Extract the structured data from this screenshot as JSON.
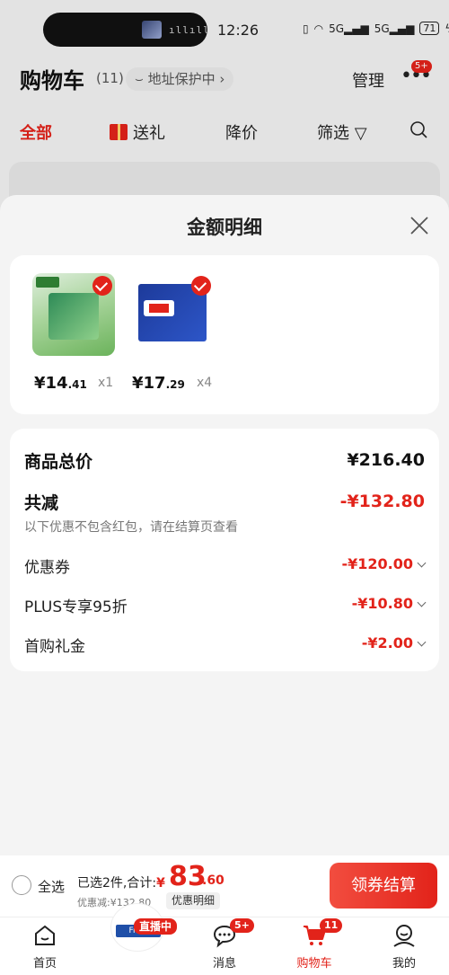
{
  "status_bar": {
    "time": "12:26",
    "network": "5G",
    "battery": "71"
  },
  "cart_header": {
    "title": "购物车",
    "count": "(11)",
    "address_protect": "地址保护中",
    "manage": "管理",
    "more_badge": "5+"
  },
  "filters": [
    "全部",
    "送礼",
    "降价",
    "筛选"
  ],
  "sheet": {
    "title": "金额明细",
    "products": [
      {
        "price_int": "¥14",
        "price_dec": ".41",
        "qty": "x1"
      },
      {
        "price_int": "¥17",
        "price_dec": ".29",
        "qty": "x4"
      }
    ],
    "summary": {
      "total_label": "商品总价",
      "total_value": "¥216.40",
      "discount_label": "共减",
      "discount_value": "-¥132.80",
      "note": "以下优惠不包含红包，请在结算页查看",
      "items": [
        {
          "label": "优惠券",
          "value": "-¥120.00"
        },
        {
          "label": "PLUS专享95折",
          "value": "-¥10.80"
        },
        {
          "label": "首购礼金",
          "value": "-¥2.00"
        }
      ]
    }
  },
  "checkout": {
    "select_all": "全选",
    "selected": "已选2件,合计:",
    "currency": "¥",
    "amount_int": "83",
    "amount_dec": ".60",
    "savings": "优惠减:¥132.80",
    "detail_label": "优惠明细",
    "pay_button": "领券结算"
  },
  "tabbar": {
    "items": [
      {
        "label": "首页"
      },
      {
        "label": "消息",
        "badge": "5+"
      },
      {
        "label": "购物车",
        "badge": "11"
      },
      {
        "label": "我的"
      }
    ],
    "live_badge": "直播中",
    "live_logo": "Friso"
  },
  "colors": {
    "accent": "#e2231a",
    "background": "#f4f4f4"
  }
}
